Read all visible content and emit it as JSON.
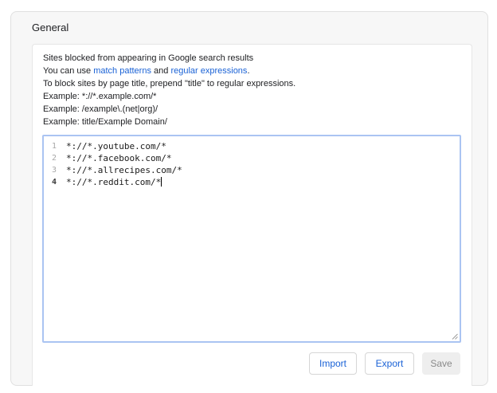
{
  "section": {
    "title": "General"
  },
  "description": {
    "line1": "Sites blocked from appearing in Google search results",
    "line2_prefix": "You can use ",
    "line2_link1": "match patterns",
    "line2_middle": " and ",
    "line2_link2": "regular expressions",
    "line2_suffix": ".",
    "line3": "To block sites by page title, prepend \"title\" to regular expressions.",
    "line4": "Example: *://*.example.com/*",
    "line5": "Example: /example\\.(net|org)/",
    "line6": "Example: title/Example Domain/"
  },
  "editor": {
    "lines": [
      {
        "number": "1",
        "text": "*://*.youtube.com/*"
      },
      {
        "number": "2",
        "text": "*://*.facebook.com/*"
      },
      {
        "number": "3",
        "text": "*://*.allrecipes.com/*"
      },
      {
        "number": "4",
        "text": "*://*.reddit.com/*"
      }
    ],
    "active_line": 4
  },
  "buttons": {
    "import": "Import",
    "export": "Export",
    "save": "Save"
  },
  "colors": {
    "link": "#1a62d6",
    "editor_border": "#aac4f2",
    "save_disabled_bg": "#eeeeee"
  }
}
